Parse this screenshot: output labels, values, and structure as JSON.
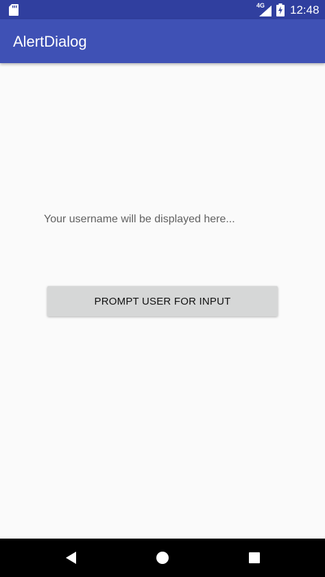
{
  "status_bar": {
    "network_type": "4G",
    "time": "12:48",
    "icons": [
      "sd-card-icon",
      "signal-icon",
      "battery-charging-icon"
    ]
  },
  "app_bar": {
    "title": "AlertDialog"
  },
  "main": {
    "username_text": "Your username will be displayed here...",
    "prompt_button_label": "PROMPT USER FOR INPUT"
  },
  "nav_bar": {
    "icons": [
      "back-icon",
      "home-icon",
      "recent-apps-icon"
    ]
  },
  "colors": {
    "status_bar": "#303f9f",
    "app_bar": "#3f51b5",
    "background": "#fafafa",
    "button": "#d6d7d7",
    "nav_bar": "#000000"
  }
}
